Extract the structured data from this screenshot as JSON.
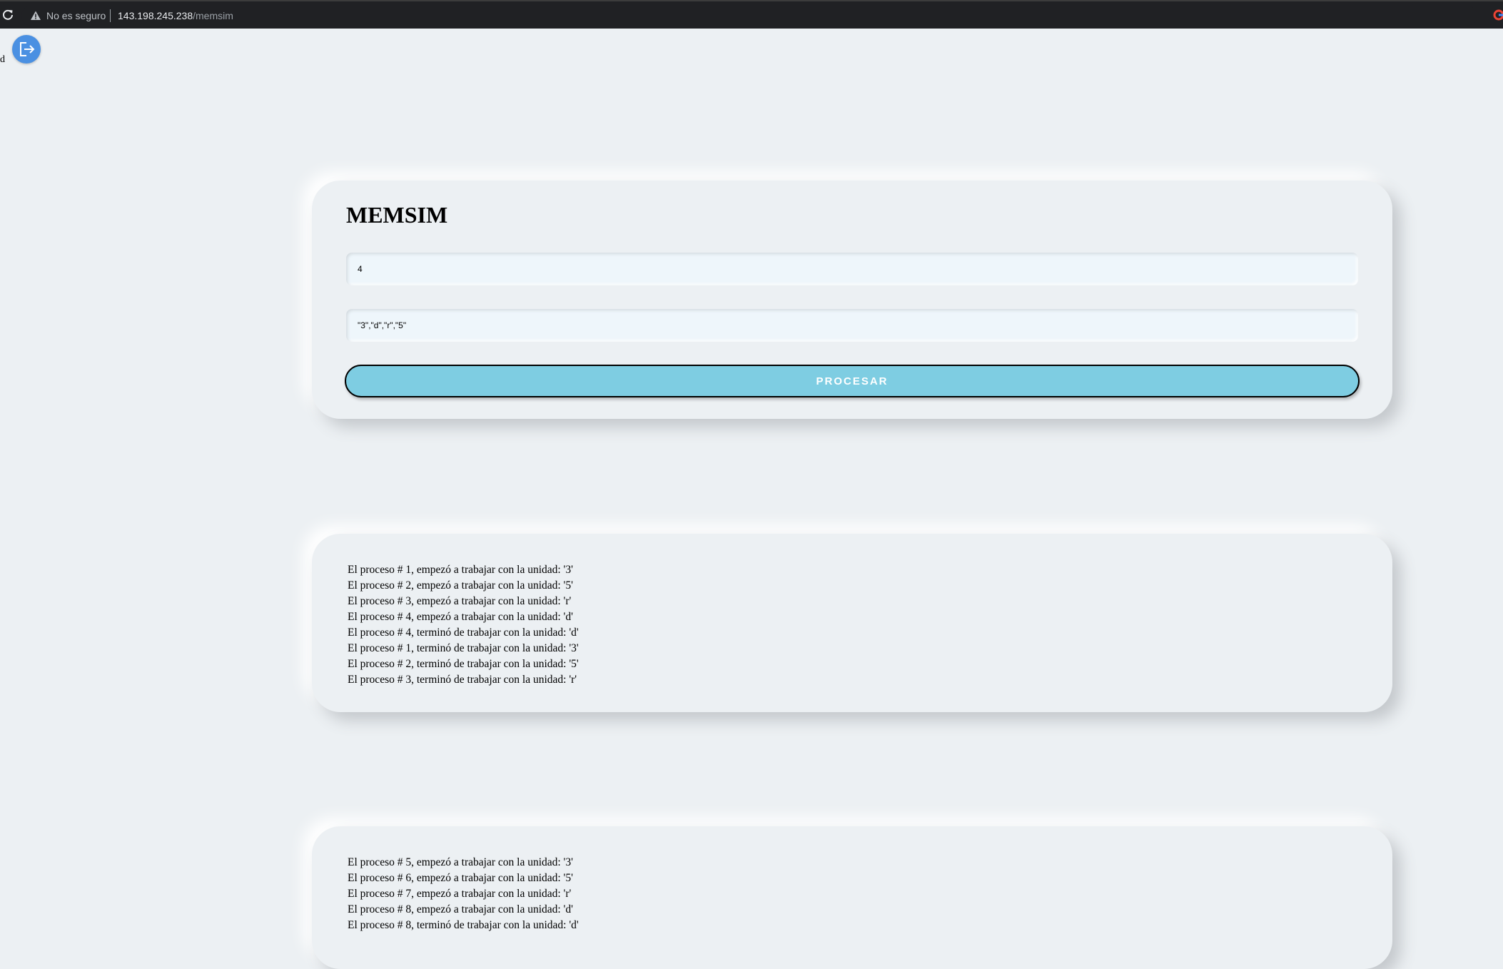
{
  "browser": {
    "security_label": "No es seguro",
    "url_host": "143.198.245.238",
    "url_path": "/memsim"
  },
  "logout": {
    "label": "d"
  },
  "form": {
    "title": "MEMSIM",
    "count_value": "4",
    "units_value": "\"3\",\"d\",\"r\",\"5\"",
    "button_label": "PROCESAR"
  },
  "output_1": [
    "El proceso # 1, empezó a trabajar con la unidad: '3'",
    "El proceso # 2, empezó a trabajar con la unidad: '5'",
    "El proceso # 3, empezó a trabajar con la unidad: 'r'",
    "El proceso # 4, empezó a trabajar con la unidad: 'd'",
    "El proceso # 4, terminó de trabajar con la unidad: 'd'",
    "El proceso # 1, terminó de trabajar con la unidad: '3'",
    "El proceso # 2, terminó de trabajar con la unidad: '5'",
    "El proceso # 3, terminó de trabajar con la unidad: 'r'"
  ],
  "output_2": [
    "El proceso # 5, empezó a trabajar con la unidad: '3'",
    "El proceso # 6, empezó a trabajar con la unidad: '5'",
    "El proceso # 7, empezó a trabajar con la unidad: 'r'",
    "El proceso # 8, empezó a trabajar con la unidad: 'd'",
    "El proceso # 8, terminó de trabajar con la unidad: 'd'"
  ],
  "colors": {
    "background": "#ecf0f3",
    "button": "#7ecde2",
    "logout": "#4a90e2"
  },
  "icons": {
    "reload": "reload-icon",
    "warning": "warning-icon",
    "logout": "logout-icon",
    "google": "google-icon"
  }
}
